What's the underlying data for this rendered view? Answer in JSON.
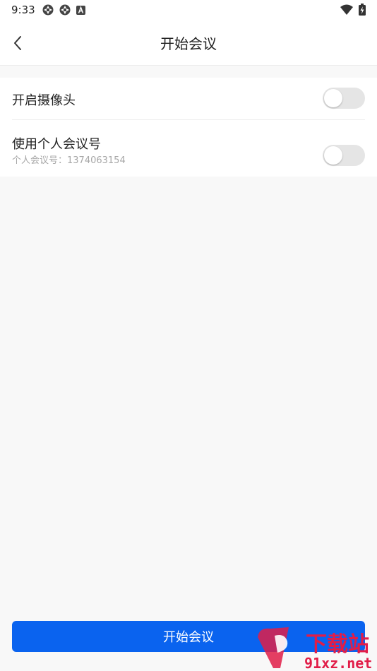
{
  "status_bar": {
    "time": "9:33",
    "left_icons": [
      "app-notification-icon",
      "app-notification-icon",
      "a-text-icon"
    ],
    "right_icons": [
      "wifi-icon",
      "battery-charging-icon"
    ]
  },
  "header": {
    "title": "开始会议",
    "back_icon": "chevron-left-icon"
  },
  "settings": {
    "camera": {
      "label": "开启摄像头",
      "enabled": false
    },
    "personal_meeting_id": {
      "label": "使用个人会议号",
      "sub_label": "个人会议号：1374063154",
      "enabled": false
    }
  },
  "actions": {
    "start_label": "开始会议"
  },
  "watermark": {
    "text_cn": "下载站",
    "text_en": "91xz.net"
  },
  "colors": {
    "accent": "#0a63ef",
    "toggle_off": "#e5e5e5",
    "background": "#f8f8f8",
    "watermark": "#e11d48"
  }
}
